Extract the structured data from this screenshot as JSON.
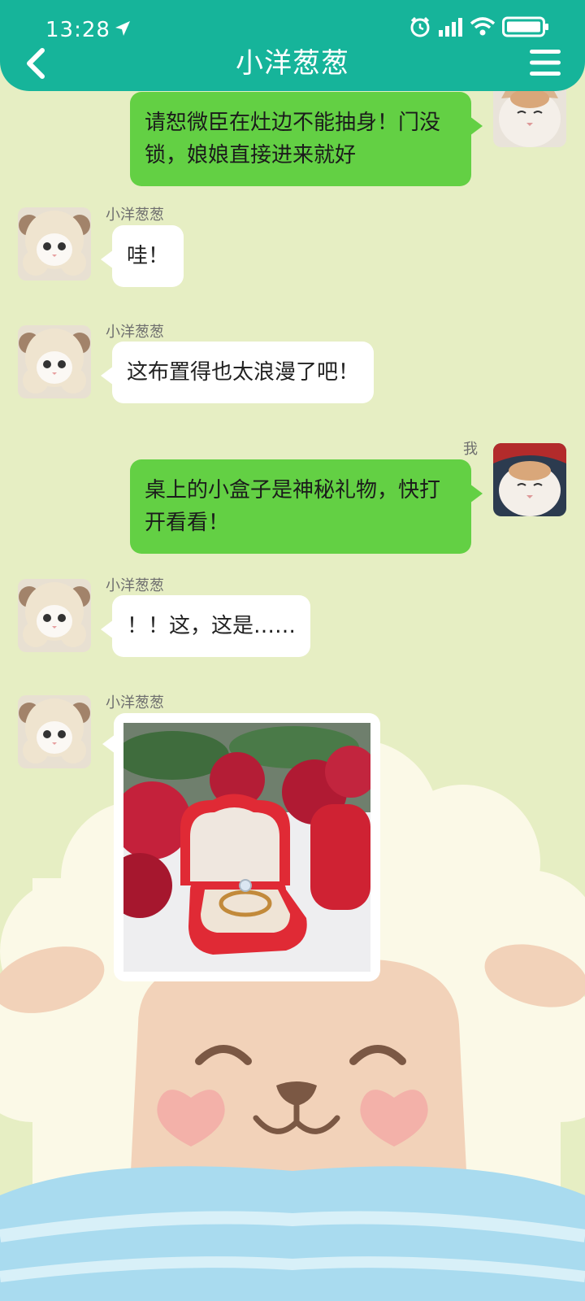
{
  "status_bar": {
    "time": "13:28"
  },
  "header": {
    "title": "小洋葱葱"
  },
  "messages": [
    {
      "side": "right",
      "text": "请恕微臣在灶边不能抽身！门没锁，娘娘直接进来就好"
    },
    {
      "side": "left",
      "sender": "小洋葱葱",
      "text": "哇！"
    },
    {
      "side": "left",
      "sender": "小洋葱葱",
      "text": "这布置得也太浪漫了吧！"
    },
    {
      "side": "right",
      "sender": "我",
      "text": "桌上的小盒子是神秘礼物，快打开看看！"
    },
    {
      "side": "left",
      "sender": "小洋葱葱",
      "text": "！！这，这是……"
    },
    {
      "side": "left",
      "sender": "小洋葱葱",
      "image": "ring-box-photo"
    }
  ],
  "colors": {
    "header": "#16b49a",
    "background": "#e6eec3",
    "bubble_right": "#63d044",
    "bubble_left": "#ffffff"
  }
}
